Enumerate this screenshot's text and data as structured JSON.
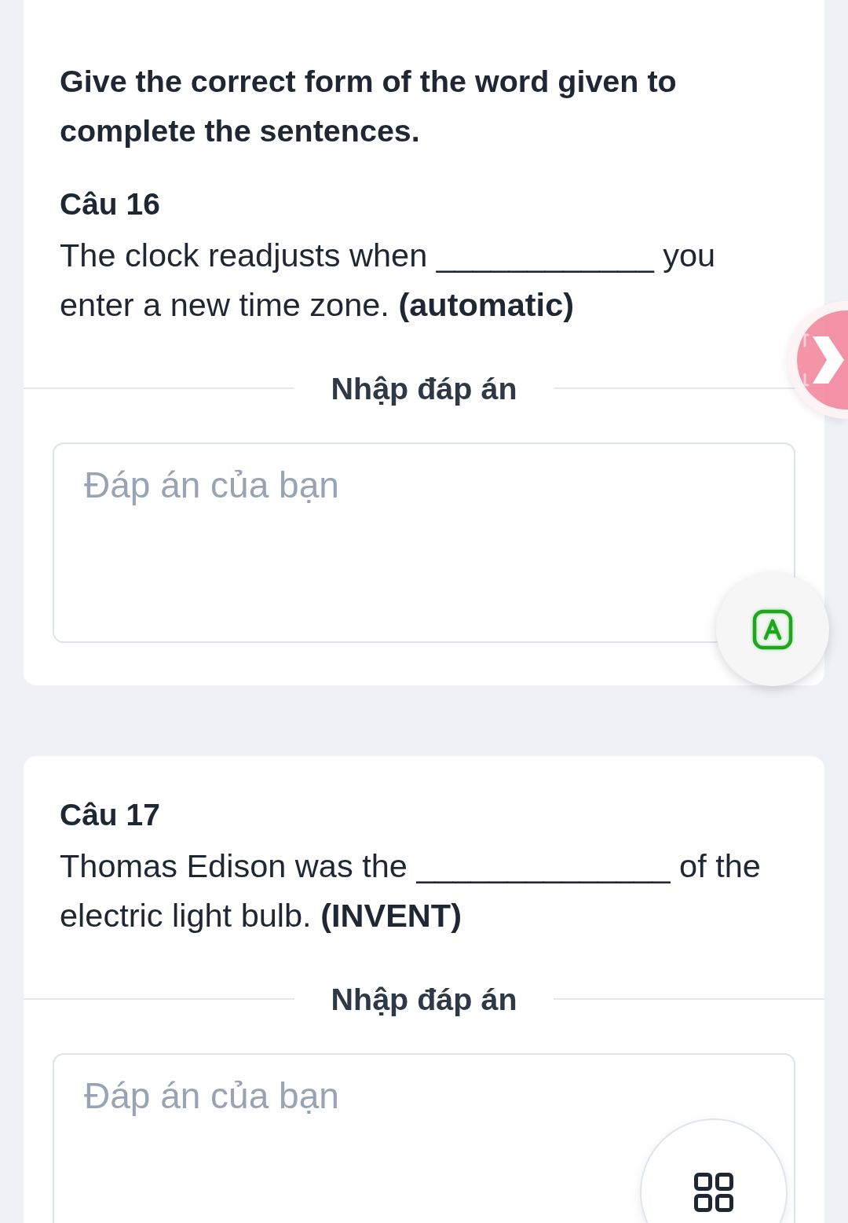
{
  "instruction": "Give the correct form of the word given to complete the sentences.",
  "questions": [
    {
      "label": "Câu 16",
      "text": "The clock readjusts when ____________ you enter a new time zone. **(automatic)**",
      "divider_label": "Nhập đáp án",
      "answer": {
        "placeholder": "Đáp án của bạn"
      }
    },
    {
      "label": "Câu 17",
      "text": "Thomas Edison was the ______________ of the electric light bulb. **(INVENT)**",
      "divider_label": "Nhập đáp án",
      "answer": {
        "placeholder": "Đáp án của bạn"
      }
    }
  ]
}
